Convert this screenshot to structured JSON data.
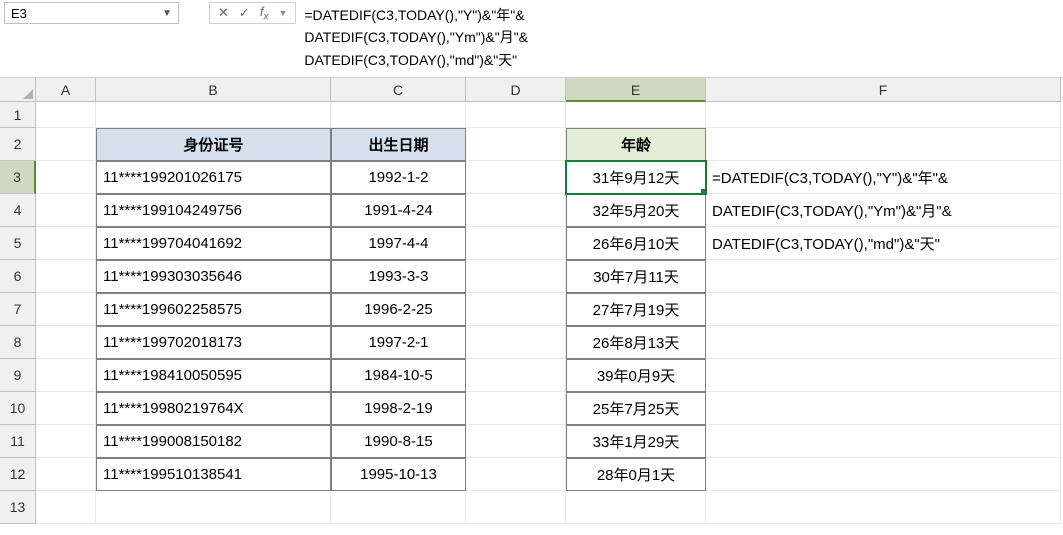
{
  "nameBox": {
    "value": "E3"
  },
  "formulaBar": {
    "lines": [
      "=DATEDIF(C3,TODAY(),\"Y\")&\"年\"&",
      "DATEDIF(C3,TODAY(),\"Ym\")&\"月\"&",
      "DATEDIF(C3,TODAY(),\"md\")&\"天\""
    ]
  },
  "columns": [
    "A",
    "B",
    "C",
    "D",
    "E",
    "F"
  ],
  "rows": [
    "1",
    "2",
    "3",
    "4",
    "5",
    "6",
    "7",
    "8",
    "9",
    "10",
    "11",
    "12",
    "13"
  ],
  "selectedCol": "E",
  "selectedRow": "3",
  "headers": {
    "id": "身份证号",
    "birth": "出生日期",
    "age": "年龄"
  },
  "tableData": [
    {
      "id": "11****199201026175",
      "birth": "1992-1-2",
      "age": "31年9月12天"
    },
    {
      "id": "11****199104249756",
      "birth": "1991-4-24",
      "age": "32年5月20天"
    },
    {
      "id": "11****199704041692",
      "birth": "1997-4-4",
      "age": "26年6月10天"
    },
    {
      "id": "11****199303035646",
      "birth": "1993-3-3",
      "age": "30年7月11天"
    },
    {
      "id": "11****199602258575",
      "birth": "1996-2-25",
      "age": "27年7月19天"
    },
    {
      "id": "11****199702018173",
      "birth": "1997-2-1",
      "age": "26年8月13天"
    },
    {
      "id": "11****198410050595",
      "birth": "1984-10-5",
      "age": "39年0月9天"
    },
    {
      "id": "11****19980219764X",
      "birth": "1998-2-19",
      "age": "25年7月25天"
    },
    {
      "id": "11****199008150182",
      "birth": "1990-8-15",
      "age": "33年1月29天"
    },
    {
      "id": "11****199510138541",
      "birth": "1995-10-13",
      "age": "28年0月1天"
    }
  ],
  "overflowF": [
    "=DATEDIF(C3,TODAY(),\"Y\")&\"年\"&",
    "DATEDIF(C3,TODAY(),\"Ym\")&\"月\"&",
    "DATEDIF(C3,TODAY(),\"md\")&\"天\""
  ]
}
